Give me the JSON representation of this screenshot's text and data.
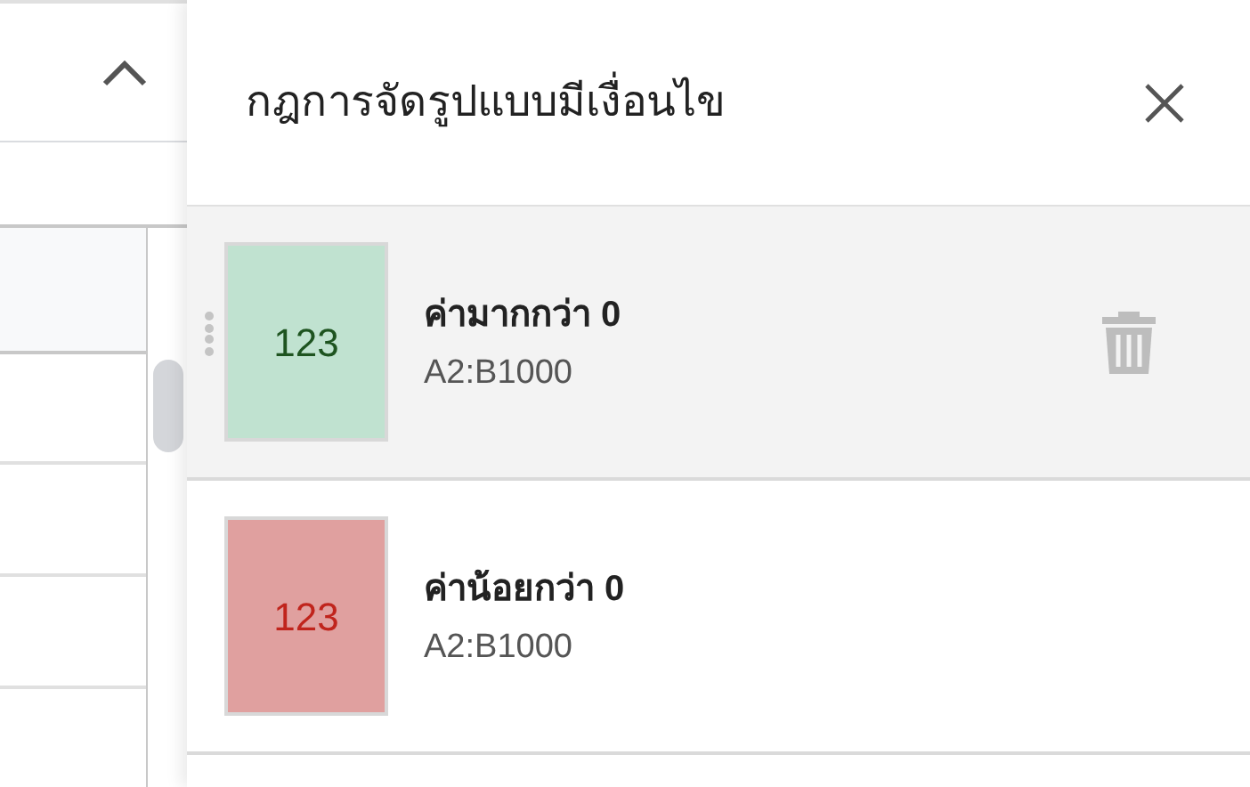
{
  "panel": {
    "title": "กฎการจัดรูปแบบมีเงื่อนไข"
  },
  "rules": [
    {
      "condition": "ค่ามากกว่า 0",
      "range": "A2:B1000",
      "preview": {
        "text": "123",
        "color": "#1e5420"
      },
      "color": "#c0e2d0",
      "hovered": true
    },
    {
      "condition": "ค่าน้อยกว่า 0",
      "range": "A2:B1000",
      "preview": {
        "text": "123",
        "color": "#c0241c"
      },
      "color": "#e0a09f",
      "hovered": false
    }
  ]
}
